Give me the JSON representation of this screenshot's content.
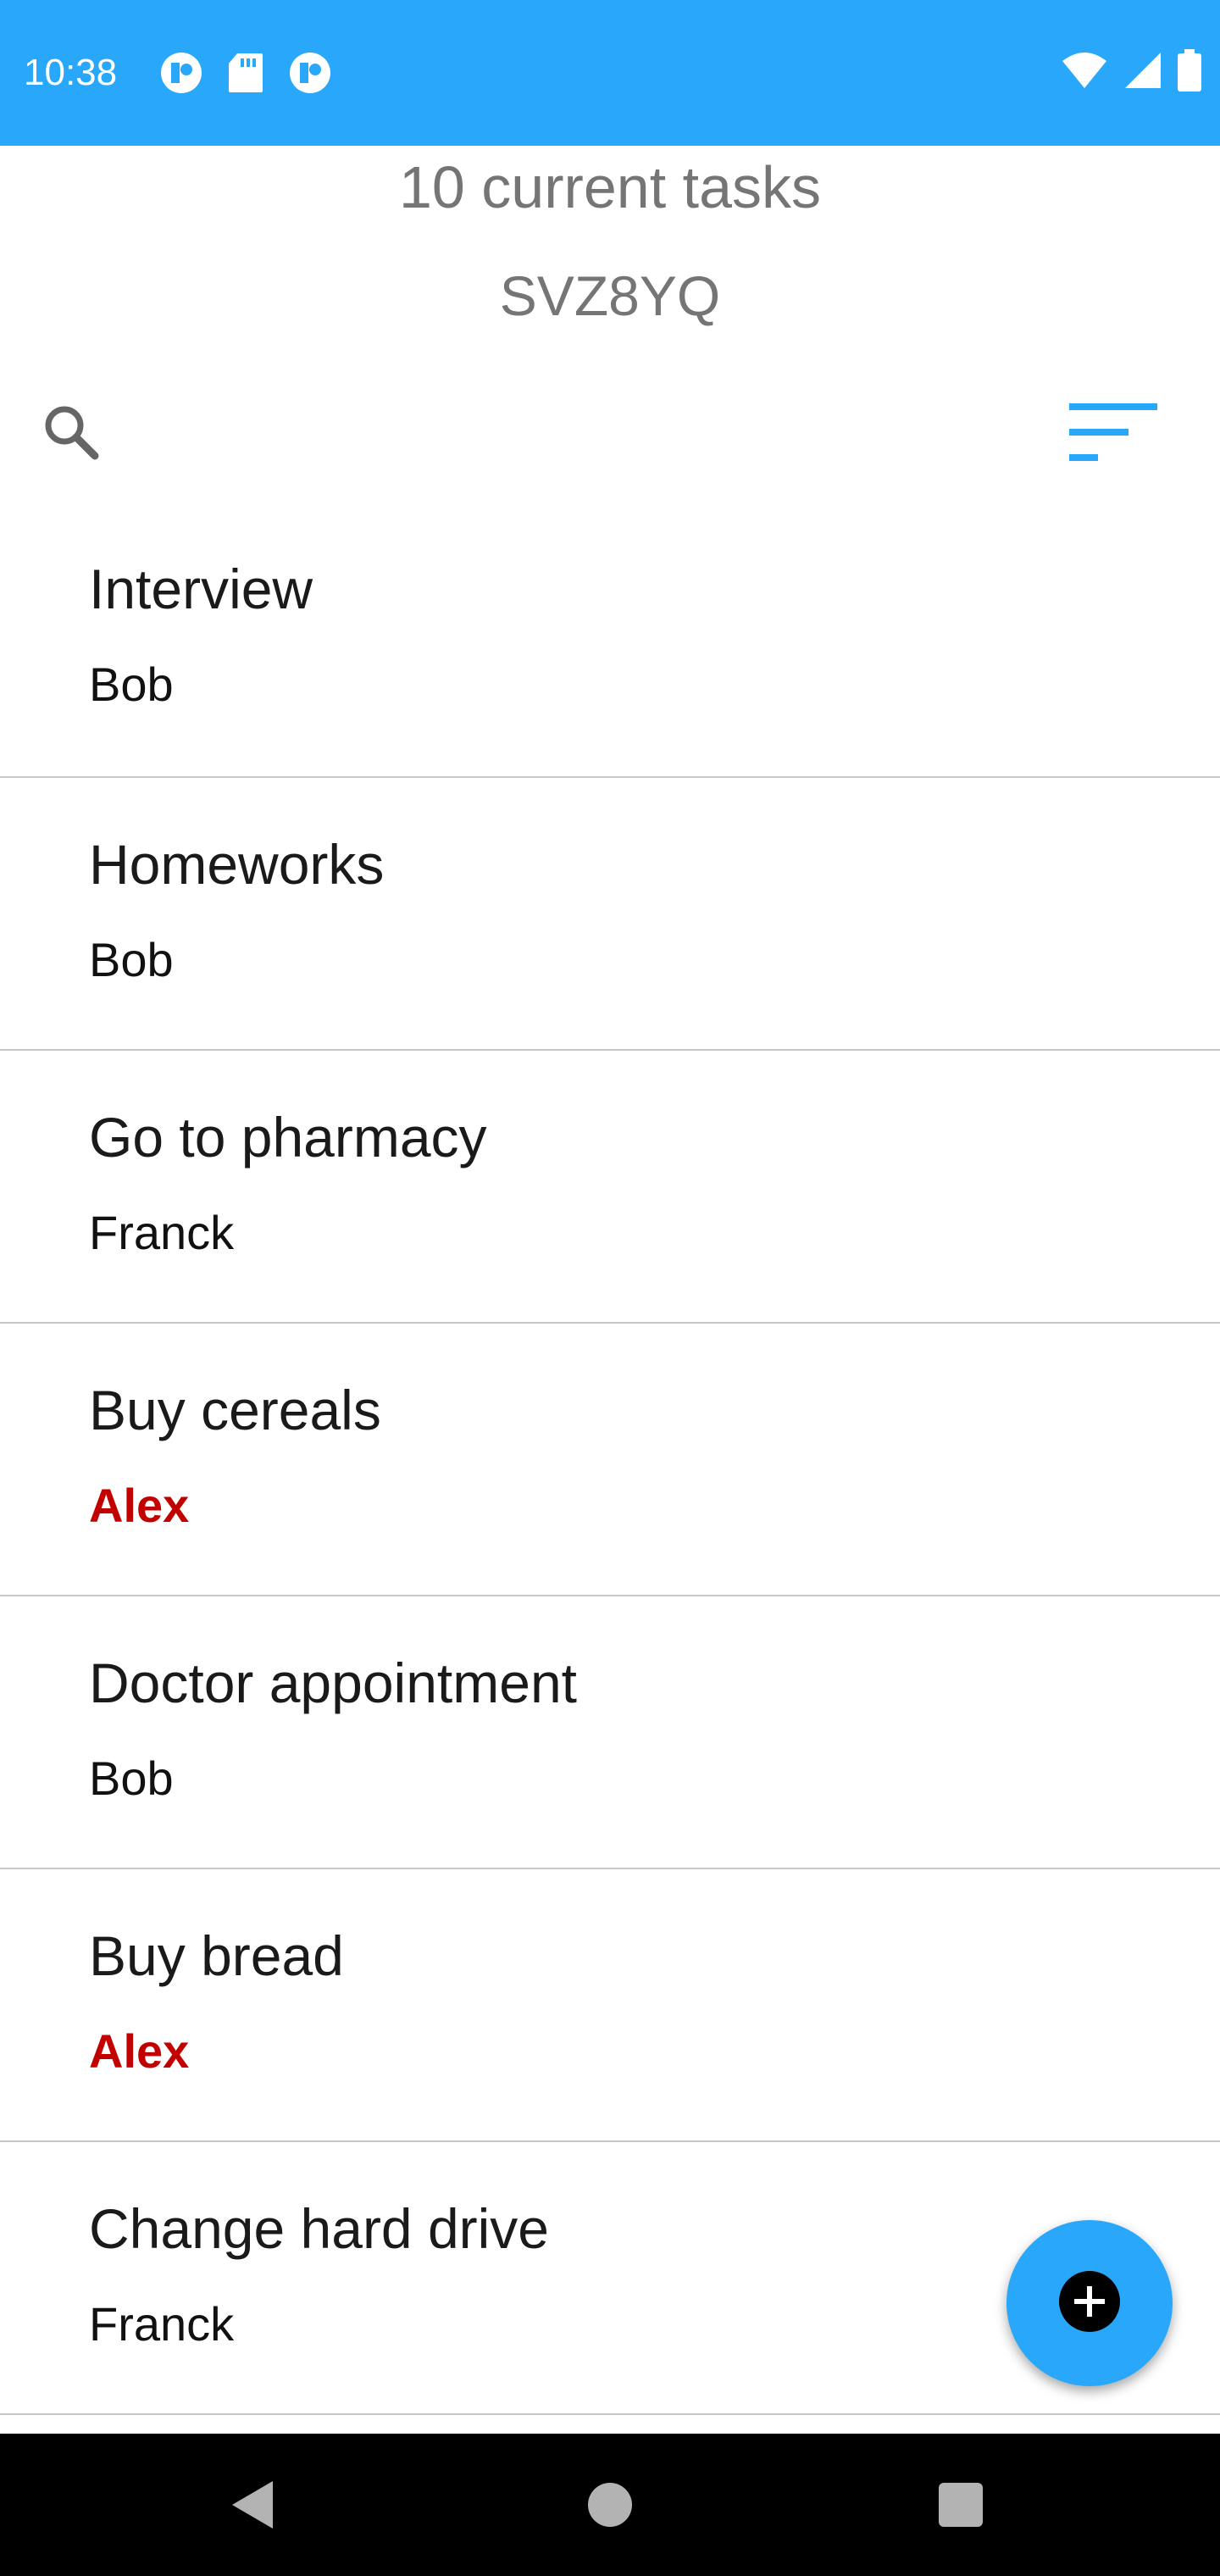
{
  "status_bar": {
    "time": "10:38",
    "left_icons": [
      "notification-app-icon",
      "sd-card-icon",
      "notification-app-icon"
    ],
    "right_icons": [
      "wifi-icon",
      "signal-icon",
      "battery-icon"
    ],
    "color": "#29a7fb"
  },
  "header": {
    "task_count": "10 current tasks",
    "code": "SVZ8YQ"
  },
  "toolbar": {
    "search_icon": "search-icon",
    "sort_icon": "sort-icon"
  },
  "tasks": [
    {
      "title": "Interview",
      "owner": "Bob",
      "highlight": false
    },
    {
      "title": "Homeworks",
      "owner": "Bob",
      "highlight": false
    },
    {
      "title": "Go to pharmacy",
      "owner": "Franck",
      "highlight": false
    },
    {
      "title": "Buy cereals",
      "owner": "Alex",
      "highlight": true
    },
    {
      "title": "Doctor appointment",
      "owner": "Bob",
      "highlight": false
    },
    {
      "title": "Buy bread",
      "owner": "Alex",
      "highlight": true
    },
    {
      "title": "Change hard drive",
      "owner": "Franck",
      "highlight": false
    }
  ],
  "fab": {
    "icon": "add-icon"
  },
  "nav_bar": {
    "buttons": [
      "back-icon",
      "home-icon",
      "recents-icon"
    ]
  },
  "colors": {
    "accent": "#29a7fb",
    "alert": "#c30000"
  }
}
